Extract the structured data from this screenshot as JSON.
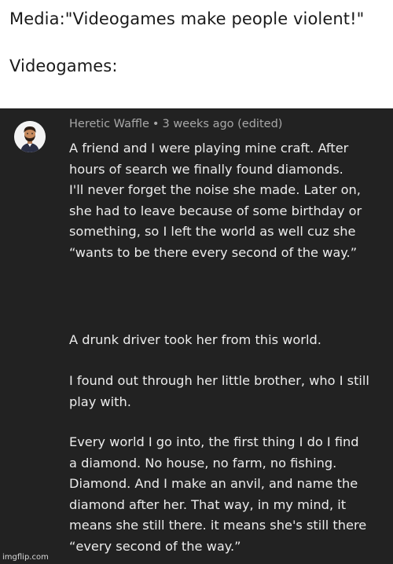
{
  "caption": {
    "line1": "Media:\"Videogames make  people violent!\"",
    "line2": "Videogames:"
  },
  "comment": {
    "author": "Heretic Waffle",
    "separator": "•",
    "time": "3 weeks ago (edited)",
    "avatar_icon": "person-avatar-icon",
    "paragraphs": [
      [
        "A friend and I were playing mine craft. After",
        "hours of search we finally found diamonds.",
        "I'll never forget the noise she made. Later on,",
        "she had to leave because of some birthday or",
        "something, so I left the world as well cuz she",
        "“wants to be there every second of the way.”"
      ],
      [
        "A drunk driver took her from this world."
      ],
      [
        "I found out through her little brother, who I still",
        "play with."
      ],
      [
        "Every world I go into, the first thing I do I find",
        "a diamond. No house, no farm, no fishing.",
        "Diamond. And I make an anvil, and name the",
        "diamond after her. That way, in my mind, it",
        "means she still there. it means she's still there",
        "“every second of the way.”"
      ]
    ]
  },
  "watermark": "imgflip.com"
}
